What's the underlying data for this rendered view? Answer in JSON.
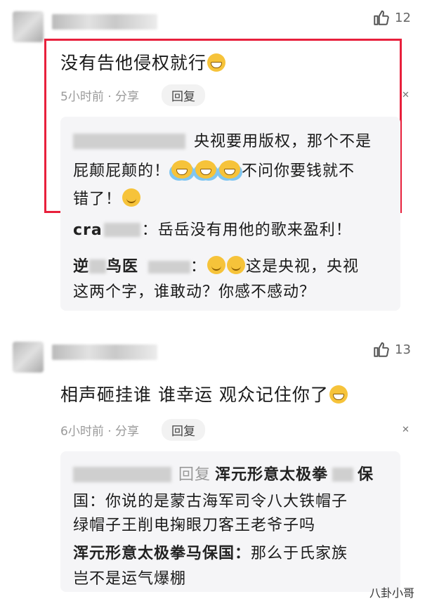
{
  "comments": [
    {
      "like_count": "12",
      "text": "没有告他侵权就行",
      "meta": "5小时前 · 分享",
      "reply_label": "回复",
      "replies": [
        {
          "pre": "央视要用版权，那个不是",
          "mid": "屁颠屁颠的！",
          "post": "不问你要钱就不",
          "end": "错了！"
        },
        {
          "name": "cra",
          "text": "：岳岳没有用他的歌来盈利！"
        },
        {
          "name": "逆",
          "name2": "鸟医",
          "sep": "：",
          "text1": "这是央视，央视",
          "text2": "这两个字，谁敢动？你感不感动？"
        }
      ]
    },
    {
      "like_count": "13",
      "text": "相声砸挂谁 谁幸运 观众记住你了",
      "meta": "6小时前 · 分享",
      "reply_label": "回复",
      "replies": [
        {
          "reply_word": "回复",
          "name": "浑元形意太极拳",
          "name_end": "保",
          "line2": "国：你说的是蒙古海军司令八大铁帽子",
          "line3": "绿帽子王削电掬眼刀客王老爷子吗"
        },
        {
          "name": "浑元形意太极拳马保国：",
          "text1": "那么于氏家族",
          "text2": "岂不是运气爆棚"
        }
      ]
    }
  ],
  "watermark": "八卦小哥",
  "colors": {
    "highlight_border": "#e8203c",
    "meta_gray": "#9a9a9a"
  },
  "icons": {
    "like": "thumbs-up-icon",
    "close": "close-icon"
  }
}
